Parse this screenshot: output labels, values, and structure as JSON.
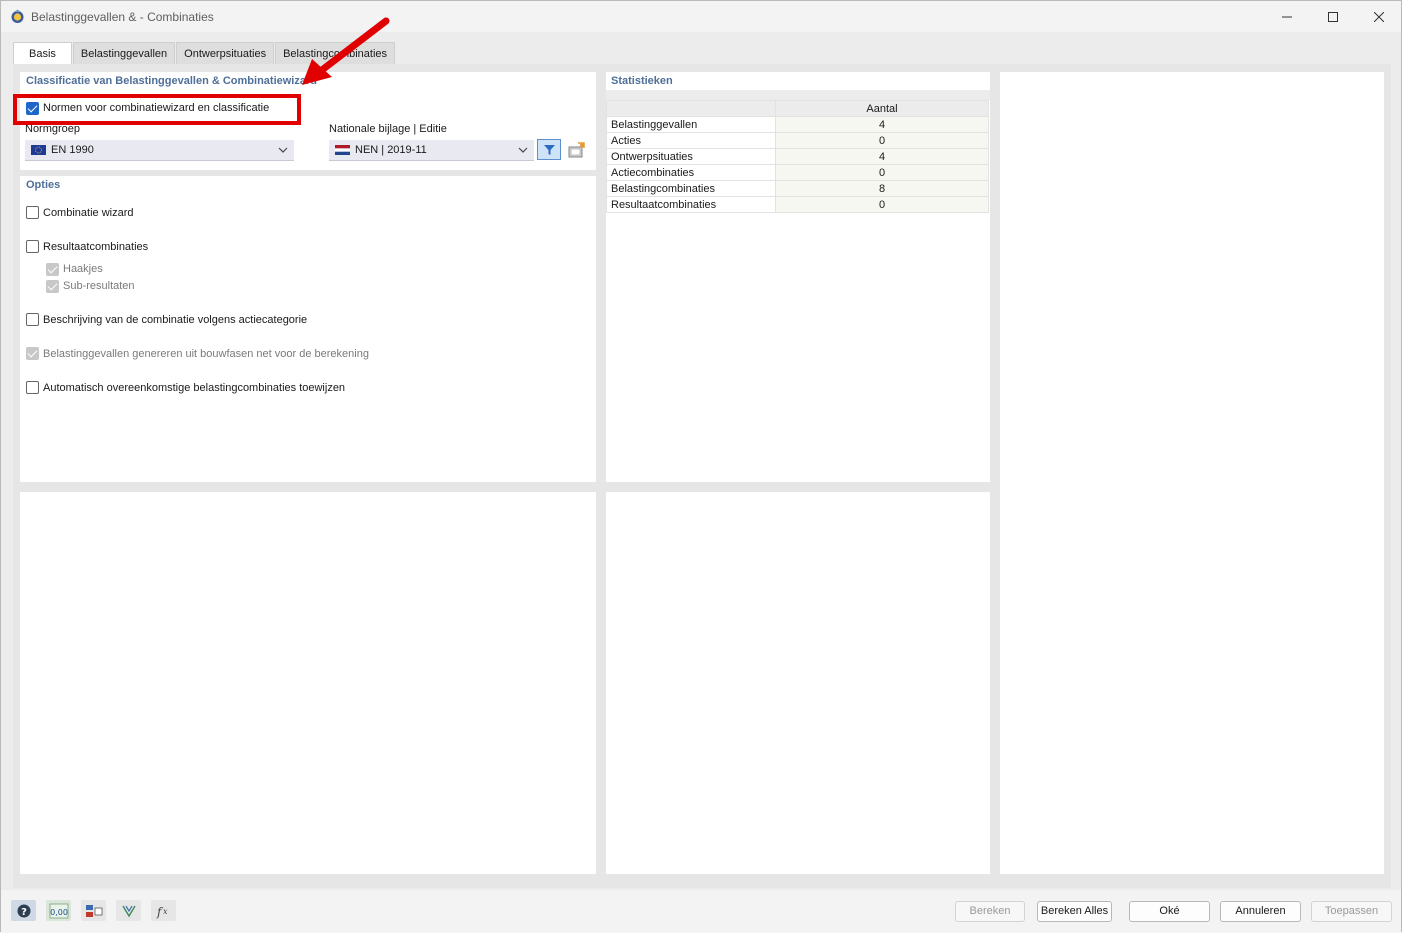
{
  "window": {
    "title": "Belastinggevallen & - Combinaties"
  },
  "tabs": [
    {
      "label": "Basis",
      "active": true
    },
    {
      "label": "Belastinggevallen",
      "active": false
    },
    {
      "label": "Ontwerpsituaties",
      "active": false
    },
    {
      "label": "Belastingcombinaties",
      "active": false
    }
  ],
  "classification": {
    "title": "Classificatie van Belastinggevallen & Combinatiewizard",
    "norms_checkbox": {
      "label": "Normen voor combinatiewizard en classificatie",
      "checked": true
    },
    "normgroep": {
      "label": "Normgroep",
      "value": "EN 1990",
      "flag": "eu-flag-icon"
    },
    "nationale_bijlage": {
      "label": "Nationale bijlage | Editie",
      "value": "NEN | 2019-11",
      "flag": "nl-flag-icon"
    }
  },
  "options": {
    "title": "Opties",
    "items": [
      {
        "label": "Combinatie wizard",
        "checked": false,
        "enabled": true
      },
      {
        "label": "Resultaatcombinaties",
        "checked": false,
        "enabled": true
      },
      {
        "label": "Haakjes",
        "checked": true,
        "enabled": false
      },
      {
        "label": "Sub-resultaten",
        "checked": true,
        "enabled": false
      },
      {
        "label": "Beschrijving van de combinatie volgens actiecategorie",
        "checked": false,
        "enabled": true
      },
      {
        "label": "Belastinggevallen genereren uit bouwfasen net voor de berekening",
        "checked": true,
        "enabled": false
      },
      {
        "label": "Automatisch overeenkomstige belastingcombinaties toewijzen",
        "checked": false,
        "enabled": true
      }
    ]
  },
  "statistics": {
    "title": "Statistieken",
    "column_header": "Aantal",
    "rows": [
      {
        "name": "Belastinggevallen",
        "value": "4"
      },
      {
        "name": "Acties",
        "value": "0"
      },
      {
        "name": "Ontwerpsituaties",
        "value": "4"
      },
      {
        "name": "Actiecombinaties",
        "value": "0"
      },
      {
        "name": "Belastingcombinaties",
        "value": "8"
      },
      {
        "name": "Resultaatcombinaties",
        "value": "0"
      }
    ]
  },
  "bottom_tools": [
    "help-icon",
    "units-icon",
    "display-icon",
    "model-icon",
    "formula-icon"
  ],
  "units_label": "0,00",
  "buttons": {
    "bereken": "Bereken",
    "bereken_alles": "Bereken Alles",
    "oke": "Oké",
    "annuleren": "Annuleren",
    "toepassen": "Toepassen"
  },
  "colors": {
    "accent": "#1e67c8",
    "section_title": "#4f6f99",
    "annotation": "#e00000"
  }
}
